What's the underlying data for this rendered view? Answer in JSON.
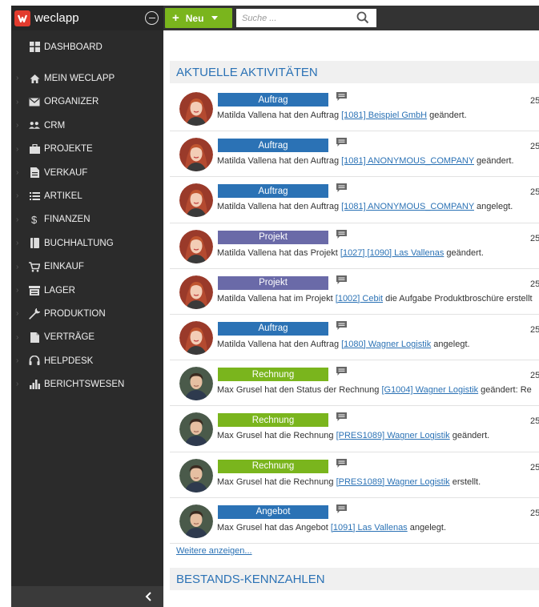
{
  "brand": {
    "name": "weclapp"
  },
  "topbar": {
    "new_label": "Neu",
    "search_placeholder": "Suche ..."
  },
  "sidebar": {
    "items": [
      {
        "label": "DASHBOARD",
        "icon": "dashboard-icon"
      },
      {
        "label": "MEIN WECLAPP",
        "icon": "home-icon"
      },
      {
        "label": "ORGANIZER",
        "icon": "mail-icon"
      },
      {
        "label": "CRM",
        "icon": "people-icon"
      },
      {
        "label": "PROJEKTE",
        "icon": "briefcase-icon"
      },
      {
        "label": "VERKAUF",
        "icon": "document-icon"
      },
      {
        "label": "ARTIKEL",
        "icon": "list-icon"
      },
      {
        "label": "FINANZEN",
        "icon": "dollar-icon"
      },
      {
        "label": "BUCHHALTUNG",
        "icon": "ledger-icon"
      },
      {
        "label": "EINKAUF",
        "icon": "cart-icon"
      },
      {
        "label": "LAGER",
        "icon": "warehouse-icon"
      },
      {
        "label": "PRODUKTION",
        "icon": "wrench-icon"
      },
      {
        "label": "VERTRÄGE",
        "icon": "contract-icon"
      },
      {
        "label": "HELPDESK",
        "icon": "headset-icon"
      },
      {
        "label": "BERICHTSWESEN",
        "icon": "bar-chart-icon"
      }
    ]
  },
  "activities_panel": {
    "title": "AKTUELLE AKTIVITÄTEN",
    "more_label": "Weitere anzeigen...",
    "items": [
      {
        "type": "Auftrag",
        "color": "#2b72b5",
        "avatar": "female",
        "date": "25",
        "prefix": "Matilda Vallena hat den Auftrag ",
        "link": "[1081] Beispiel GmbH",
        "suffix": " geändert."
      },
      {
        "type": "Auftrag",
        "color": "#2b72b5",
        "avatar": "female",
        "date": "25",
        "prefix": "Matilda Vallena hat den Auftrag ",
        "link": "[1081] ANONYMOUS_COMPANY",
        "suffix": " geändert."
      },
      {
        "type": "Auftrag",
        "color": "#2b72b5",
        "avatar": "female",
        "date": "25",
        "prefix": "Matilda Vallena hat den Auftrag ",
        "link": "[1081] ANONYMOUS_COMPANY",
        "suffix": " angelegt."
      },
      {
        "type": "Projekt",
        "color": "#6a6aa8",
        "avatar": "female",
        "date": "25",
        "prefix": "Matilda Vallena hat das Projekt ",
        "link": "[1027] [1090] Las Vallenas",
        "suffix": " geändert."
      },
      {
        "type": "Projekt",
        "color": "#6a6aa8",
        "avatar": "female",
        "date": "25",
        "prefix": "Matilda Vallena hat im Projekt ",
        "link": "[1002] Cebit",
        "suffix": " die Aufgabe Produktbroschüre erstellt"
      },
      {
        "type": "Auftrag",
        "color": "#2b72b5",
        "avatar": "female",
        "date": "25",
        "prefix": "Matilda Vallena hat den Auftrag ",
        "link": "[1080] Wagner Logistik",
        "suffix": " angelegt."
      },
      {
        "type": "Rechnung",
        "color": "#7ab51d",
        "avatar": "male",
        "date": "25",
        "prefix": "Max Grusel hat den Status der Rechnung ",
        "link": "[G1004] Wagner Logistik",
        "suffix": " geändert: Re"
      },
      {
        "type": "Rechnung",
        "color": "#7ab51d",
        "avatar": "male",
        "date": "25",
        "prefix": "Max Grusel hat die Rechnung ",
        "link": "[PRES1089] Wagner Logistik",
        "suffix": " geändert."
      },
      {
        "type": "Rechnung",
        "color": "#7ab51d",
        "avatar": "male",
        "date": "25",
        "prefix": "Max Grusel hat die Rechnung ",
        "link": "[PRES1089] Wagner Logistik",
        "suffix": " erstellt."
      },
      {
        "type": "Angebot",
        "color": "#2b72b5",
        "avatar": "male",
        "date": "25",
        "prefix": "Max Grusel hat das Angebot ",
        "link": "[1091] Las Vallenas",
        "suffix": " angelegt."
      }
    ]
  },
  "kpi_panel": {
    "title": "BESTANDS-KENNZAHLEN"
  }
}
